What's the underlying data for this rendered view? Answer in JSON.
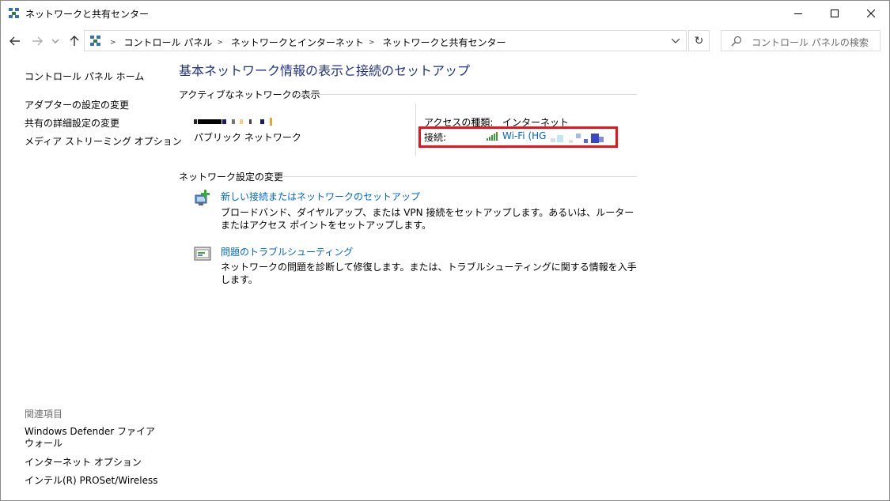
{
  "window": {
    "title": "ネットワークと共有センター"
  },
  "address_bar": {
    "crumbs": [
      "コントロール パネル",
      "ネットワークとインターネット",
      "ネットワークと共有センター"
    ],
    "search_placeholder": "コントロール パネルの検索"
  },
  "left_pane": {
    "home": "コントロール パネル ホーム",
    "links": [
      "アダプターの設定の変更",
      "共有の詳細設定の変更",
      "メディア ストリーミング オプション"
    ],
    "see_also_title": "関連項目",
    "see_also": [
      "Windows Defender ファイアウォール",
      "インターネット オプション",
      "インテル(R) PROSet/Wireless"
    ]
  },
  "main": {
    "title": "基本ネットワーク情報の表示と接続のセットアップ",
    "active_networks_heading": "アクティブなネットワークの表示",
    "network_type": "パブリック ネットワーク",
    "access_type_label": "アクセスの種類:",
    "access_type_value": "インターネット",
    "connection_label": "接続:",
    "connection_value": "Wi-Fi (HG",
    "change_settings_heading": "ネットワーク設定の変更",
    "tasks": [
      {
        "link": "新しい接続またはネットワークのセットアップ",
        "desc": "ブロードバンド、ダイヤルアップ、または VPN 接続をセットアップします。あるいは、ルーターまたはアクセス ポイントをセットアップします。"
      },
      {
        "link": "問題のトラブルシューティング",
        "desc": "ネットワークの問題を診断して修復します。または、トラブルシューティングに関する情報を入手します。"
      }
    ]
  },
  "colors": {
    "title_blue": "#1e3287",
    "link_blue": "#0066cc",
    "highlight_red": "#e8141c"
  }
}
